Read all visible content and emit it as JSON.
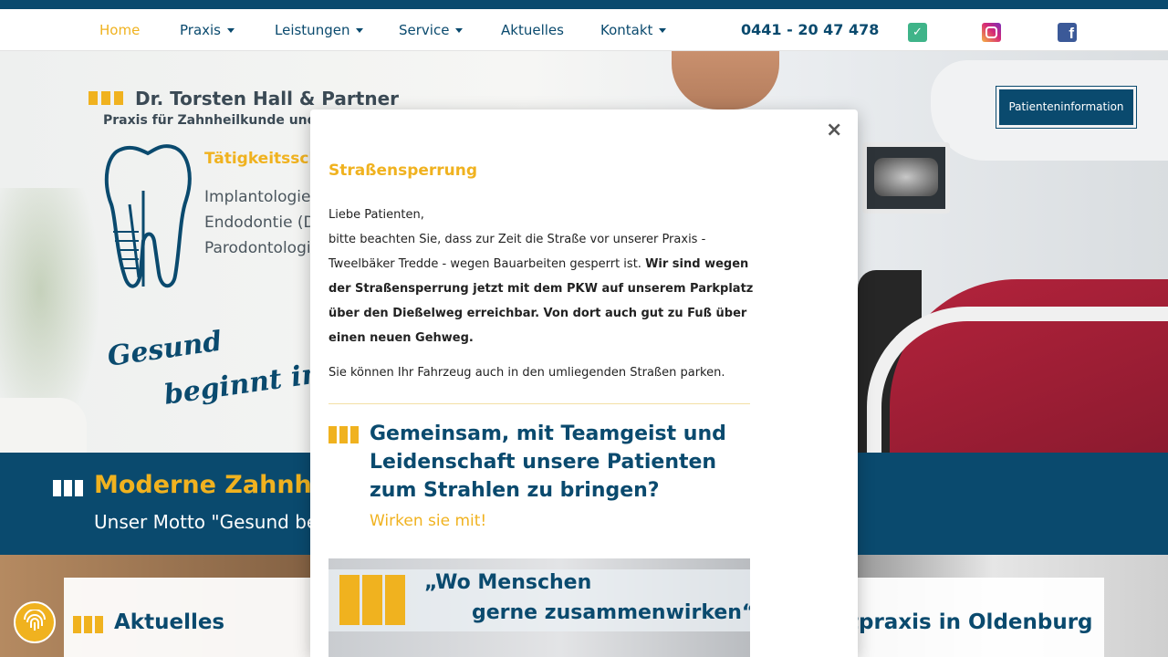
{
  "nav": {
    "items": [
      {
        "label": "Home",
        "active": true,
        "dropdown": false
      },
      {
        "label": "Praxis",
        "active": false,
        "dropdown": true
      },
      {
        "label": "Leistungen",
        "active": false,
        "dropdown": true
      },
      {
        "label": "Service",
        "active": false,
        "dropdown": true
      },
      {
        "label": "Aktuelles",
        "active": false,
        "dropdown": false
      },
      {
        "label": "Kontakt",
        "active": false,
        "dropdown": true
      }
    ],
    "phone": "0441 - 20 47 478",
    "social": [
      "jameda-icon",
      "instagram-icon",
      "facebook-icon"
    ]
  },
  "hero": {
    "logo_title": "Dr. Torsten Hall & Partner",
    "logo_subtitle": "Praxis für Zahnheilkunde und",
    "focus_title": "Tätigkeitsschw",
    "focus_items": [
      "Implantologie",
      "Endodontie (D",
      "Parodontologie"
    ],
    "slogan_line1": "Gesund",
    "slogan_line2": "beginnt im M",
    "patient_button": "Patienteninformation"
  },
  "banner": {
    "title": "Moderne Zahnheil",
    "subtitle": "Unser Motto \"Gesund be"
  },
  "cards": {
    "left_title": "Aktuelles",
    "right_title": "tpraxis in Oldenburg"
  },
  "modal": {
    "close": "×",
    "heading": "Straßensperrung",
    "greeting": "Liebe Patienten,",
    "line1": "bitte beachten Sie, dass zur Zeit die Straße vor unserer Praxis -",
    "line2": "Tweelbäker Tredde - wegen Bauarbeiten gesperrt ist.",
    "bold_text": "Wir sind wegen der Straßensperrung jetzt mit dem PKW auf unserem Parkplatz über den Dießelweg erreichbar. Von dort auch gut zu Fuß über einen neuen Gehweg.",
    "parking": "Sie können Ihr Fahrzeug auch in den umliegenden Straßen parken.",
    "teaser_title": "Gemeinsam, mit Teamgeist und Leidenschaft unsere Patienten zum Strahlen zu bringen?",
    "teaser_cta": "Wirken sie mit!",
    "image_quote_line1": "„Wo Menschen",
    "image_quote_line2": "gerne zusammenwirken“"
  },
  "colors": {
    "brand_blue": "#0a4a6e",
    "accent_yellow": "#f0b21f"
  }
}
